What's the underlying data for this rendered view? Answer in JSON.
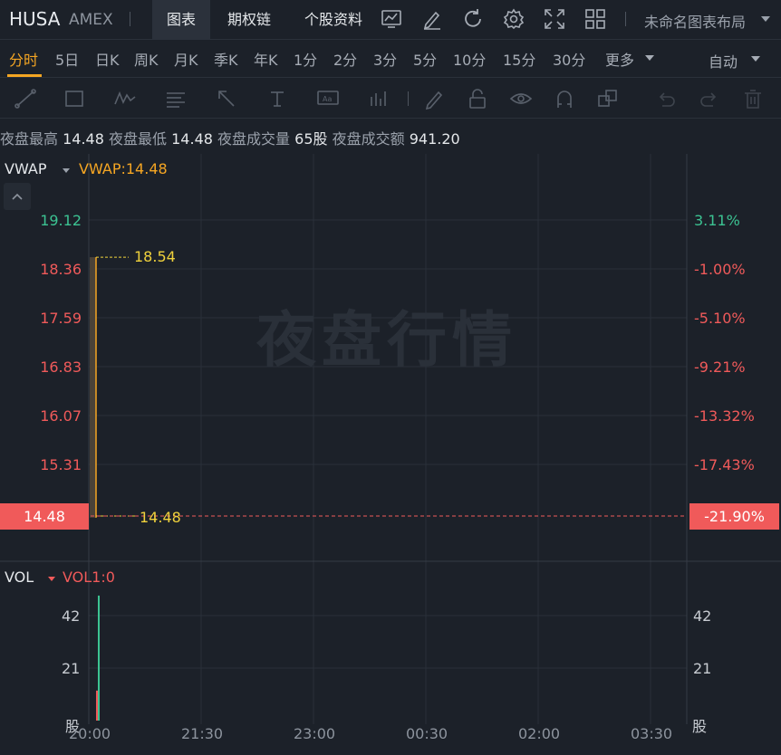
{
  "header": {
    "symbol": "HUSA",
    "exchange": "AMEX",
    "tabs": [
      {
        "label": "图表",
        "active": true
      },
      {
        "label": "期权链",
        "active": false
      },
      {
        "label": "个股资料",
        "active": false
      }
    ],
    "icons": [
      "indicator-icon",
      "draw-pen-icon",
      "refresh-icon",
      "settings-icon",
      "fullscreen-icon",
      "layout-grid-icon"
    ],
    "layout_name": "未命名图表布局"
  },
  "periods": {
    "items": [
      "分时",
      "5日",
      "日K",
      "周K",
      "月K",
      "季K",
      "年K",
      "1分",
      "2分",
      "3分",
      "5分",
      "10分",
      "15分",
      "30分"
    ],
    "active": "分时",
    "more": "更多",
    "auto": "自动"
  },
  "draw_tools": [
    "trend-line-icon",
    "rectangle-icon",
    "wave-pattern-icon",
    "fibonacci-icon",
    "arrow-icon",
    "text-icon",
    "annotation-icon",
    "bar-pattern-icon",
    "brush-icon",
    "lock-icon",
    "visibility-icon",
    "magnet-icon",
    "layers-icon",
    "undo-icon",
    "redo-icon",
    "trash-icon"
  ],
  "session_info": {
    "high_label": "夜盘最高",
    "high_value": "14.48",
    "low_label": "夜盘最低",
    "low_value": "14.48",
    "volume_label": "夜盘成交量",
    "volume_value": "65股",
    "turnover_label": "夜盘成交额",
    "turnover_value": "941.20"
  },
  "main_indicator": {
    "name": "VWAP",
    "value_text": "VWAP:14.48"
  },
  "watermark": "夜盘行情",
  "price_axis": [
    "19.12",
    "18.36",
    "17.59",
    "16.83",
    "16.07",
    "15.31"
  ],
  "pct_axis": [
    "3.11%",
    "-1.00%",
    "-5.10%",
    "-9.21%",
    "-13.32%",
    "-17.43%"
  ],
  "current": {
    "price": "14.48",
    "pct": "-21.90%"
  },
  "markers": {
    "high": "18.54",
    "low": "14.48"
  },
  "vol_indicator": {
    "name": "VOL",
    "value_text": "VOL1:0"
  },
  "vol_axis": [
    "42",
    "21"
  ],
  "vol_unit": "股",
  "time_axis": [
    "20:00",
    "21:30",
    "23:00",
    "00:30",
    "02:00",
    "03:30"
  ],
  "colors": {
    "background": "#1c2129",
    "accent": "#f5a623",
    "up": "#3cc392",
    "down": "#f05a5a",
    "marker": "#f0d23c"
  },
  "chart_data": {
    "type": "line",
    "series": [
      {
        "name": "VWAP",
        "x": [
          "20:00",
          "20:00"
        ],
        "values": [
          18.54,
          14.48
        ]
      }
    ],
    "volume": [
      {
        "x": "20:00",
        "value": 50,
        "color": "up"
      },
      {
        "x": "20:00",
        "value": 12,
        "color": "down"
      }
    ],
    "ylim": [
      14.0,
      19.5
    ]
  }
}
